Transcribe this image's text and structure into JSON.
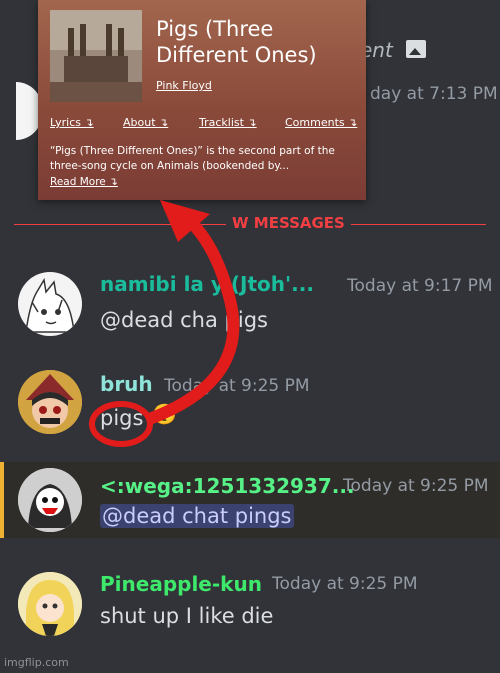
{
  "card": {
    "title": "Pigs (Three Different Ones)",
    "artist": "Pink Floyd",
    "links": [
      "Lyrics ↴",
      "About ↴",
      "Tracklist ↴",
      "Comments ↴"
    ],
    "description": "“Pigs (Three Different Ones)” is the second part of the three-song cycle on Animals (bookended by...",
    "read_more": "Read More ↴"
  },
  "background": {
    "top_text": "ent",
    "top_time": "day at 7:13 PM",
    "divider": "W MESSAGES"
  },
  "messages": [
    {
      "username": "namibi  la  y (Jtoh'...",
      "time": "Today at 9:17 PM",
      "text": "@dead cha  pigs",
      "name_color": "#1abc9c"
    },
    {
      "username": "bruh",
      "time": "Today at 9:25 PM",
      "text": "pigs",
      "emoji": "🥺",
      "name_color": "#8fe3d8"
    },
    {
      "username": "<:wega:1251332937...",
      "time": "Today at 9:25 PM",
      "text": "@dead chat pings",
      "name_color": "#57f287"
    },
    {
      "username": "Pineapple-kun",
      "time": "Today at 9:25 PM",
      "text": "shut up I like die",
      "name_color": "#3ee86b"
    }
  ],
  "colors": {
    "accent_red": "#e21b1b",
    "divider_red": "#f23f43",
    "highlight_bar": "#f0b232"
  },
  "watermark": "imgflip.com"
}
